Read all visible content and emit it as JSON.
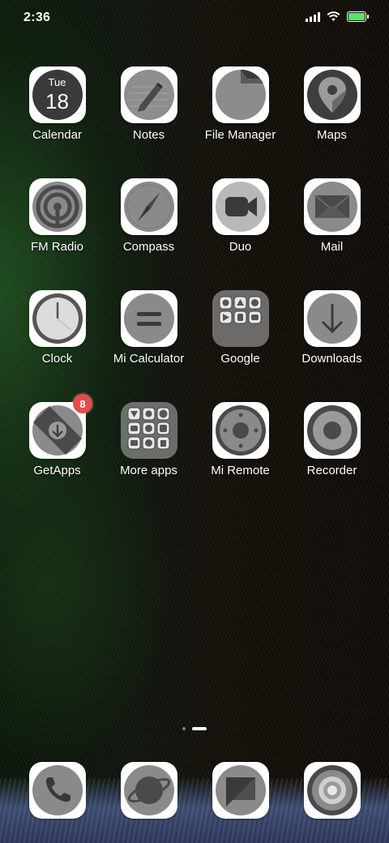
{
  "status_bar": {
    "time": "2:36",
    "battery_level": 1.0,
    "battery_color": "#5ce06b"
  },
  "calendar_icon": {
    "day": "Tue",
    "date": "18"
  },
  "apps": [
    {
      "label": "Calendar",
      "icon": "calendar-icon"
    },
    {
      "label": "Notes",
      "icon": "notes-icon"
    },
    {
      "label": "File Manager",
      "icon": "folder-icon"
    },
    {
      "label": "Maps",
      "icon": "map-pin-icon"
    },
    {
      "label": "FM Radio",
      "icon": "radio-icon"
    },
    {
      "label": "Compass",
      "icon": "compass-icon"
    },
    {
      "label": "Duo",
      "icon": "video-camera-icon"
    },
    {
      "label": "Mail",
      "icon": "envelope-icon"
    },
    {
      "label": "Clock",
      "icon": "clock-icon"
    },
    {
      "label": "Mi Calculator",
      "icon": "calculator-icon"
    },
    {
      "label": "Google",
      "icon": "app-folder-icon"
    },
    {
      "label": "Downloads",
      "icon": "download-arrow-icon"
    },
    {
      "label": "GetApps",
      "icon": "getapps-icon",
      "badge": "8"
    },
    {
      "label": "More apps",
      "icon": "app-folder-icon"
    },
    {
      "label": "Mi Remote",
      "icon": "remote-icon"
    },
    {
      "label": "Recorder",
      "icon": "record-icon"
    }
  ],
  "pages": {
    "count": 2,
    "current": 2
  },
  "dock": [
    {
      "icon": "phone-icon"
    },
    {
      "icon": "browser-planet-icon"
    },
    {
      "icon": "message-icon"
    },
    {
      "icon": "camera-lens-icon"
    }
  ],
  "colors": {
    "badge": "#e84b4b",
    "icon_tile": "#ffffff",
    "icon_gray": "#8a8a8a"
  }
}
